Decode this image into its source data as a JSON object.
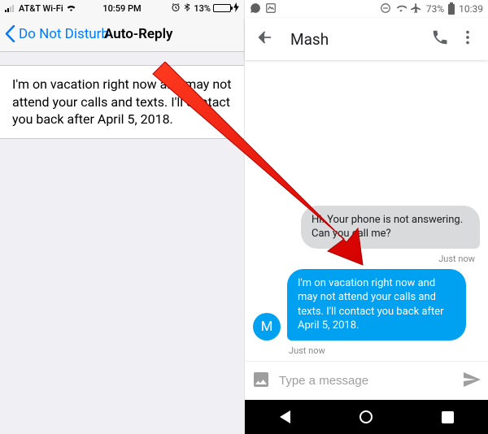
{
  "ios": {
    "status": {
      "carrier": "AT&T Wi-Fi",
      "time": "10:59 PM",
      "battery_pct": "13%"
    },
    "nav": {
      "back_label": "Do Not Disturb",
      "title": "Auto-Reply"
    },
    "message": "I'm on vacation right now and may not attend your calls and texts. I'll contact you back after April 5, 2018."
  },
  "android": {
    "status": {
      "battery_pct": "73%",
      "time": "10:39"
    },
    "header": {
      "contact_name": "Mash"
    },
    "chat": {
      "outgoing_text": "Hi. Your phone is not answering. Can you call me?",
      "outgoing_time": "Just now",
      "incoming_avatar": "M",
      "incoming_text": "I'm on vacation right now and may not attend your calls and texts. I'll contact you back after April 5, 2018.",
      "incoming_time": "Just now"
    },
    "input": {
      "placeholder": "Type a message"
    }
  }
}
